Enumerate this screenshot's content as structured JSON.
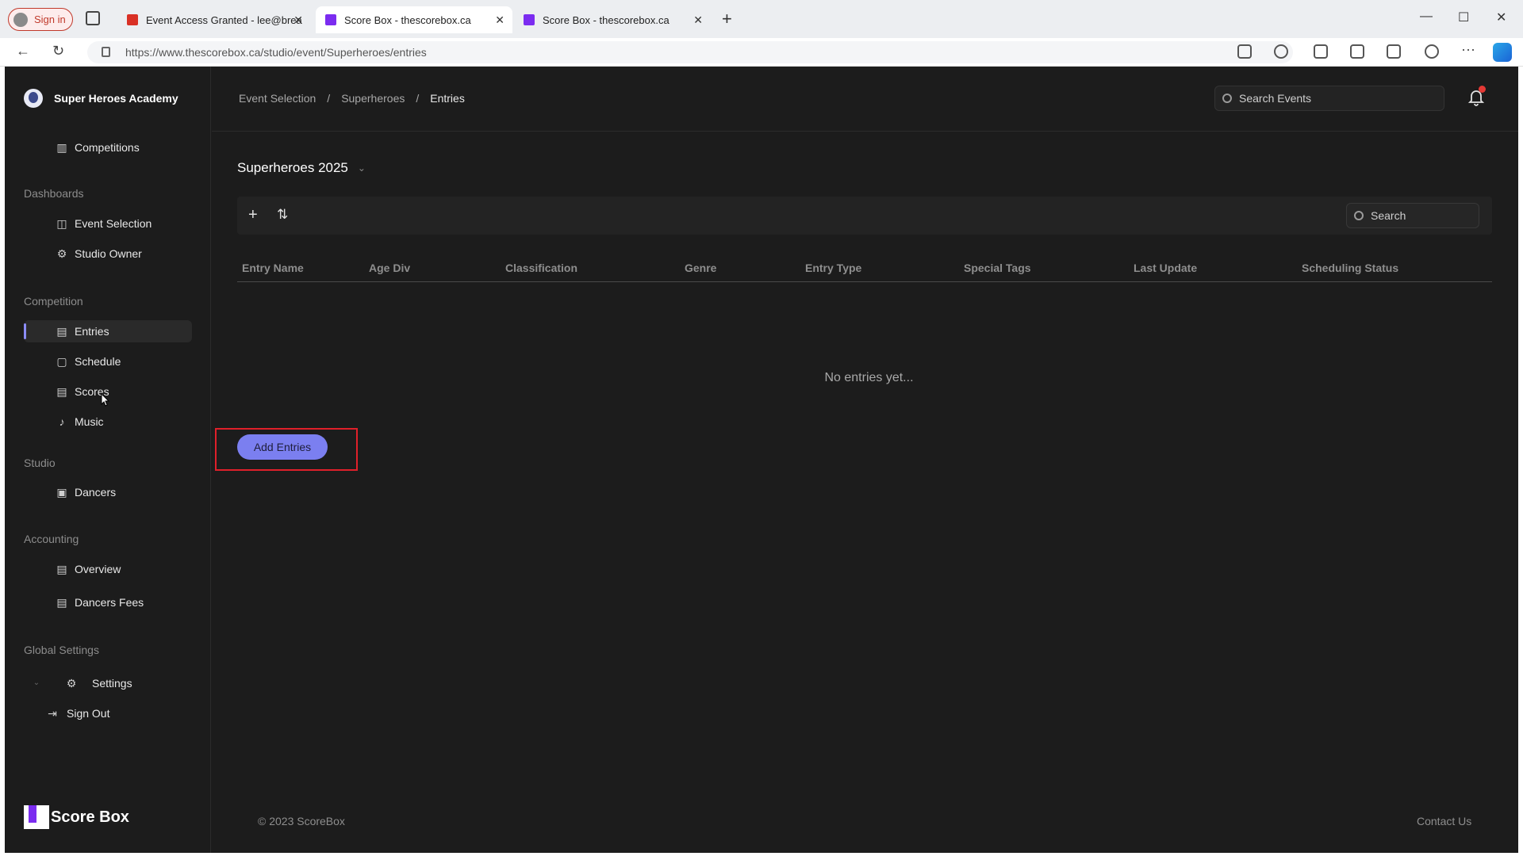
{
  "browser": {
    "signin_label": "Sign in",
    "tabs": [
      {
        "label": "Event Access Granted - lee@brea",
        "favicon_color": "#d93025"
      },
      {
        "label": "Score Box - thescorebox.ca",
        "favicon_color": "#7b2cf0"
      },
      {
        "label": "Score Box - thescorebox.ca",
        "favicon_color": "#7b2cf0"
      }
    ],
    "url": "https://www.thescorebox.ca/studio/event/Superheroes/entries"
  },
  "sidebar": {
    "studio_name": "Super Heroes Academy",
    "top_item": "Competitions",
    "sections": {
      "dashboards": "Dashboards",
      "competition": "Competition",
      "studio": "Studio",
      "accounting": "Accounting",
      "global": "Global Settings"
    },
    "items": {
      "event_selection": "Event Selection",
      "studio_owner": "Studio Owner",
      "entries": "Entries",
      "schedule": "Schedule",
      "scores": "Scores",
      "music": "Music",
      "dancers": "Dancers",
      "overview": "Overview",
      "dancers_fees": "Dancers Fees",
      "settings": "Settings",
      "sign_out": "Sign Out"
    },
    "footer_brand": "Score Box"
  },
  "header": {
    "breadcrumb": [
      "Event Selection",
      "/",
      "Superheroes",
      "/",
      "Entries"
    ],
    "search_placeholder": "Search Events"
  },
  "main": {
    "event_title": "Superheroes 2025",
    "search_placeholder": "Search",
    "columns": [
      "Entry Name",
      "Age Div",
      "Classification",
      "Genre",
      "Entry Type",
      "Special Tags",
      "Last Update",
      "Scheduling Status"
    ],
    "empty_text": "No entries yet...",
    "add_button": "Add Entries"
  },
  "footer": {
    "copyright": "© 2023 ScoreBox",
    "contact": "Contact Us"
  },
  "colors": {
    "accent": "#7b7ff0",
    "background": "#1c1c1c",
    "highlight": "#e0202a"
  }
}
